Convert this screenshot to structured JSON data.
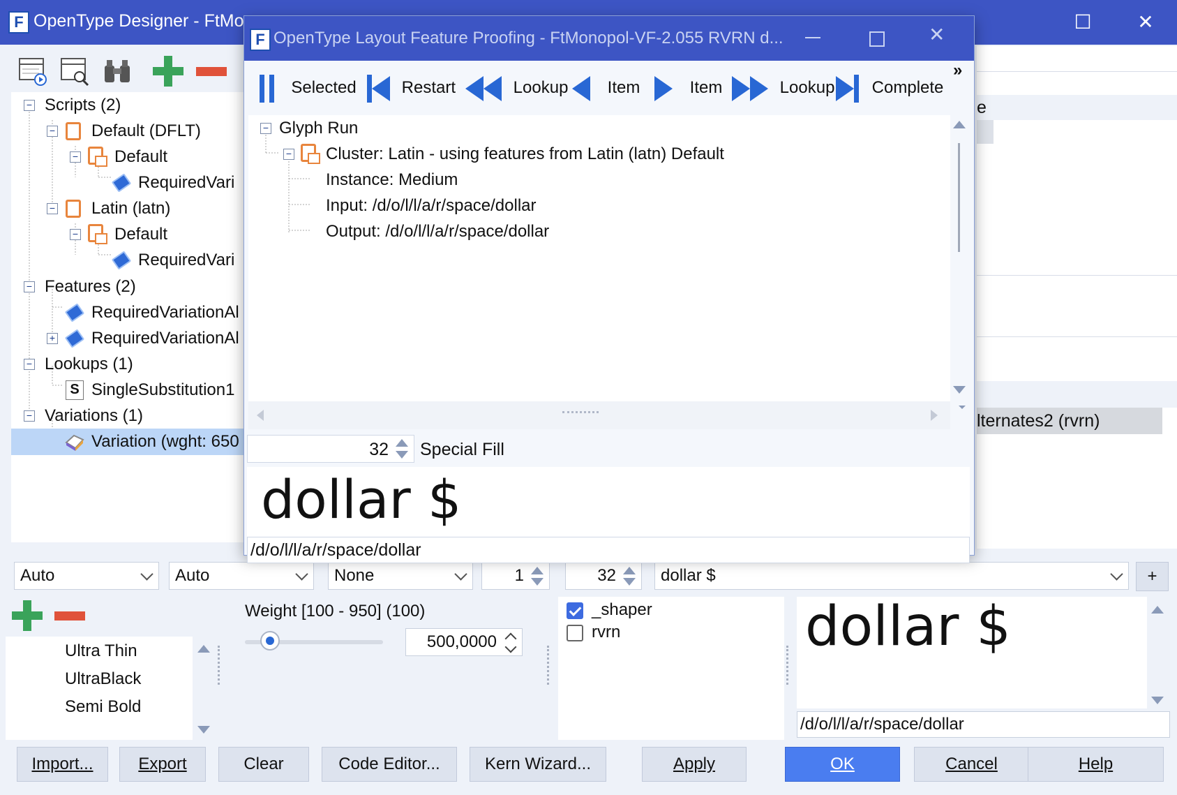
{
  "main_window": {
    "title": "OpenType Designer - FtMon",
    "toolbar_icons": [
      "table-play-icon",
      "table-search-icon",
      "binoculars-icon",
      "add-icon",
      "remove-icon"
    ]
  },
  "tree": {
    "scripts": "Scripts (2)",
    "default_dflt": "Default (DFLT)",
    "default_1": "Default",
    "required_1": "RequiredVari",
    "latin": "Latin (latn)",
    "default_2": "Default",
    "required_2": "RequiredVari",
    "features": "Features (2)",
    "feature_1": "RequiredVariationAl",
    "feature_2": "RequiredVariationAl",
    "lookups": "Lookups (1)",
    "lookup_1": "SingleSubstitution1",
    "lookup_1_badge": "S",
    "variations": "Variations (1)",
    "variation_1": "Variation (wght: 650"
  },
  "right_pane": {
    "header_fragment": "e",
    "selected_row": "lternates2 (rvrn)"
  },
  "dialog": {
    "title": "OpenType Layout Feature Proofing - FtMonopol-VF-2.055 RVRN d...",
    "nav": {
      "selected": "Selected",
      "restart": "Restart",
      "lookup_prev": "Lookup",
      "item_prev": "Item",
      "item_next": "Item",
      "lookup_next": "Lookup",
      "complete": "Complete",
      "overflow": "»"
    },
    "glyph_run": {
      "root": "Glyph Run",
      "cluster": "Cluster: Latin - using features from Latin (latn) Default",
      "instance": "Instance: Medium",
      "input": "Input: /d/o/l/l/a/r/space/dollar",
      "output": "Output: /d/o/l/l/a/r/space/dollar"
    },
    "size_value": "32",
    "special_fill": "Special Fill",
    "preview_text": "dollar $",
    "glyph_input": "/d/o/l/l/a/r/space/dollar"
  },
  "bottom": {
    "combo_1": "Auto",
    "combo_2": "Auto",
    "combo_3": "None",
    "spin_1": "1",
    "spin_2": "32",
    "text_combo": "dollar $",
    "add_button": "+",
    "instances": [
      "Ultra Thin",
      "UltraBlack",
      "Semi Bold"
    ],
    "weight_label": "Weight [100 - 950] (100)",
    "weight_value": "500,0000",
    "weight_slider_fraction": 0.18,
    "features": [
      {
        "label": "_shaper",
        "checked": true
      },
      {
        "label": "rvrn",
        "checked": false
      }
    ],
    "preview_text": "dollar $",
    "glyph_input": "/d/o/l/l/a/r/space/dollar"
  },
  "buttons": {
    "import": "Import...",
    "export": "Export",
    "clear": "Clear",
    "code_editor": "Code Editor...",
    "kern_wizard": "Kern Wizard...",
    "apply": "Apply",
    "ok": "OK",
    "cancel": "Cancel",
    "help": "Help"
  },
  "colors": {
    "titlebar": "#3d55c4",
    "accent": "#2867d4",
    "ok_button": "#4a7df0",
    "selection": "#bcd6f7"
  }
}
